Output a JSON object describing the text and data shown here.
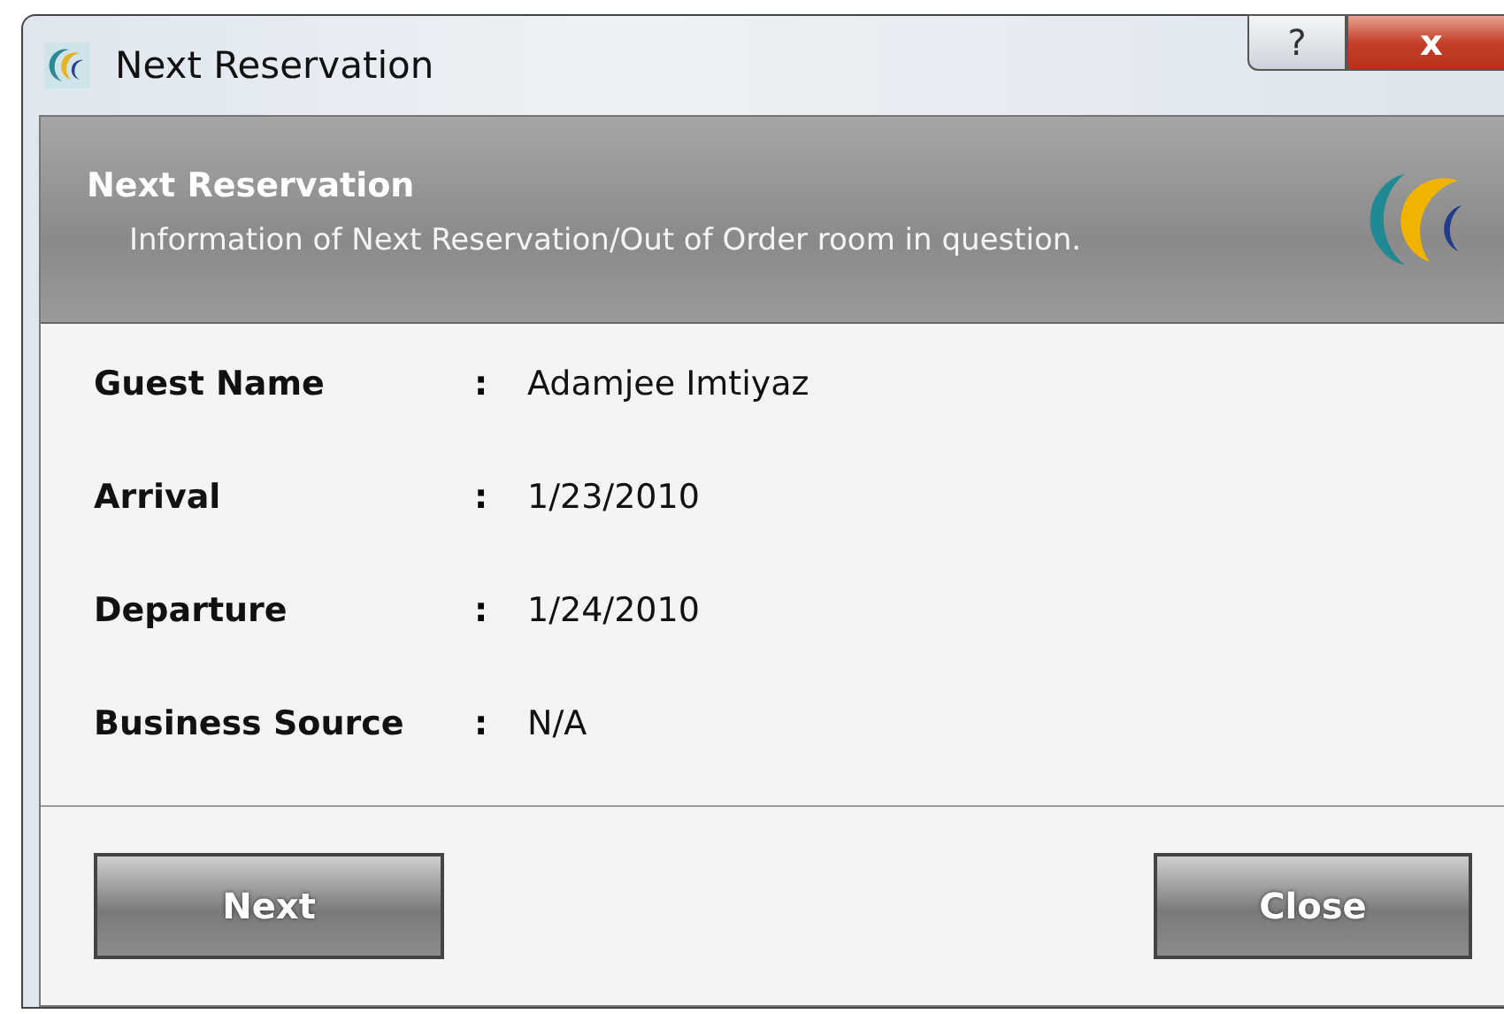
{
  "window": {
    "title": "Next Reservation",
    "help_button": "?",
    "close_button": "x"
  },
  "header": {
    "title": "Next Reservation",
    "subtitle": "Information of Next Reservation/Out of Order room in question."
  },
  "fields": [
    {
      "label": "Guest Name",
      "separator": ":",
      "value": "Adamjee Imtiyaz"
    },
    {
      "label": "Arrival",
      "separator": ":",
      "value": "1/23/2010"
    },
    {
      "label": "Departure",
      "separator": ":",
      "value": "1/24/2010"
    },
    {
      "label": "Business Source",
      "separator": ":",
      "value": "N/A"
    }
  ],
  "buttons": [
    {
      "label": "Next"
    },
    {
      "label": "Close"
    }
  ]
}
